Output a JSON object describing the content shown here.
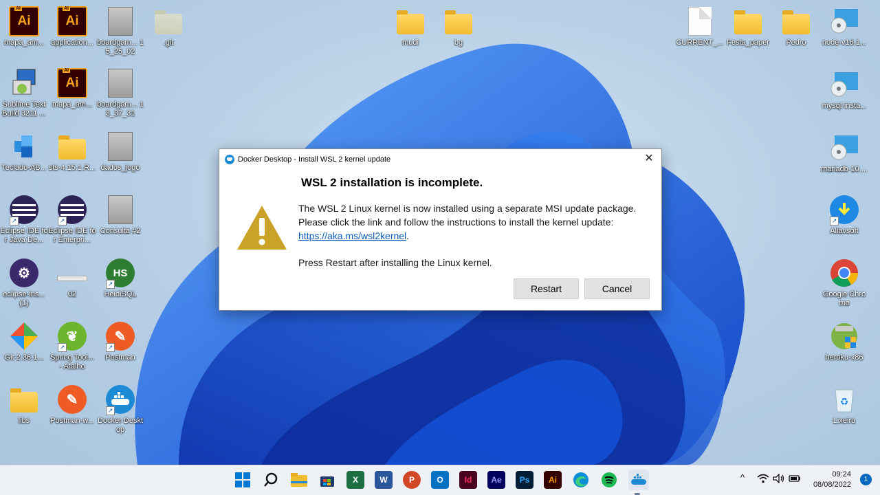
{
  "desktop": {
    "icons": [
      {
        "label": "mapa_am..."
      },
      {
        "label": "application..."
      },
      {
        "label": "boardgam... 15_25_02"
      },
      {
        "label": ".git"
      },
      {
        "label": "mudi"
      },
      {
        "label": "bg"
      },
      {
        "label": "CURRENT_..."
      },
      {
        "label": "Festa_paper"
      },
      {
        "label": "Pedro"
      },
      {
        "label": "node-v16.1..."
      },
      {
        "label": "Sublime Text Build 3211 ..."
      },
      {
        "label": "mapa_am..."
      },
      {
        "label": "boardgam... 13_37_31"
      },
      {
        "label": "mysql-insta..."
      },
      {
        "label": "Teclado-AB..."
      },
      {
        "label": "sts-4.15.1.R..."
      },
      {
        "label": "dados_jogo"
      },
      {
        "label": "mariadb-10...."
      },
      {
        "label": "Eclipse IDE for Java De..."
      },
      {
        "label": "Eclipse IDE for Enterpri..."
      },
      {
        "label": "Consulta #2"
      },
      {
        "label": "Allavsoft"
      },
      {
        "label": "eclipse-ins... (1)"
      },
      {
        "label": "02"
      },
      {
        "label": "HeidiSQL"
      },
      {
        "label": "Google Chrome"
      },
      {
        "label": "Git 2.36.1..."
      },
      {
        "label": "Spring Tool... - Atalho"
      },
      {
        "label": "Postman"
      },
      {
        "label": "heroku-x86"
      },
      {
        "label": "libs"
      },
      {
        "label": "Postman-w..."
      },
      {
        "label": "Docker Desktop"
      },
      {
        "label": "Lixeira"
      }
    ]
  },
  "dialog": {
    "title": "Docker Desktop - Install WSL 2 kernel update",
    "heading": "WSL 2 installation is incomplete.",
    "line1": "The WSL 2 Linux kernel is now installed using a separate MSI update package.",
    "line2": "Please click the link and follow the instructions to install the kernel update:",
    "link": "https://aka.ms/wsl2kernel",
    "link_suffix": ".",
    "line3": "Press Restart after installing the Linux kernel.",
    "restart_label": "Restart",
    "cancel_label": "Cancel",
    "close_glyph": "✕"
  },
  "taskbar": {
    "apps": [
      {
        "name": "start-icon"
      },
      {
        "name": "search-icon"
      },
      {
        "name": "file-explorer-icon"
      },
      {
        "name": "store-icon"
      },
      {
        "name": "excel-icon",
        "text": "X"
      },
      {
        "name": "word-icon",
        "text": "W"
      },
      {
        "name": "powerpoint-icon",
        "text": "P"
      },
      {
        "name": "outlook-icon",
        "text": "O"
      },
      {
        "name": "indesign-icon",
        "text": "Id"
      },
      {
        "name": "aftereffects-icon",
        "text": "Ae"
      },
      {
        "name": "photoshop-icon",
        "text": "Ps"
      },
      {
        "name": "illustrator-icon",
        "text": "Ai"
      },
      {
        "name": "edge-icon"
      },
      {
        "name": "spotify-icon"
      },
      {
        "name": "docker-icon"
      }
    ],
    "time": "09:24",
    "date": "08/08/2022",
    "notifications": "1",
    "chevron": "^"
  },
  "colors": {
    "accent": "#0067c0",
    "link": "#0b5cb8",
    "warning": "#c9a227",
    "button_bg": "#e1e1e1"
  }
}
